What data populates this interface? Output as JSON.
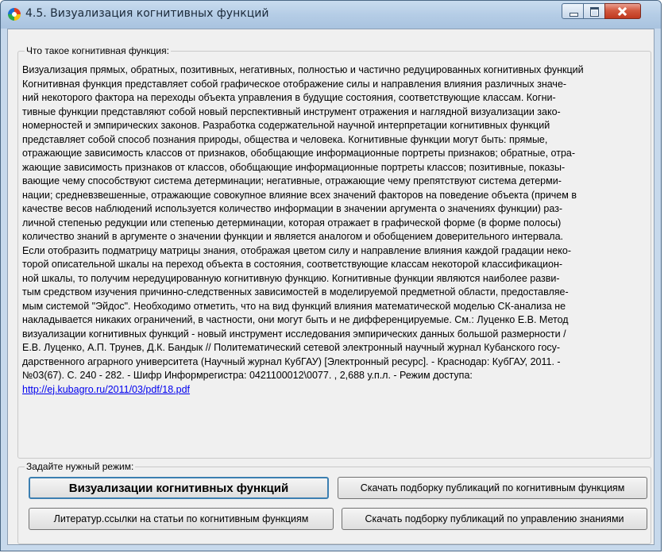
{
  "window": {
    "title": "4.5. Визуализация когнитивных функций"
  },
  "group_description": {
    "title": "Что такое когнитивная функция:",
    "lines": [
      "Визуализация прямых, обратных, позитивных, негативных, полностью и частично редуцированных когнитивных функций",
      "Когнитивная функция представляет собой графическое отображение силы и направления влияния различных значе-",
      "ний некоторого фактора на переходы объекта управления в будущие состояния, соответствующие классам. Когни-",
      "тивные функции представляют собой новый перспективный инструмент отражения и наглядной визуализации зако-",
      "номерностей и эмпирических законов. Разработка содержательной научной интерпретации когнитивных функций",
      "представляет собой способ познания природы, общества и человека. Когнитивные функции могут быть: прямые,",
      "отражающие зависимость классов от признаков, обобщающие информационные портреты признаков; обратные, отра-",
      "жающие зависимость признаков от классов, обобщающие информационные портреты классов; позитивные, показы-",
      "вающие чему способствуют система детерминации; негативные, отражающие чему препятствуют система детерми-",
      "нации; средневзвешенные, отражающие совокупное влияние всех значений факторов на поведение объекта (причем в",
      "качестве весов наблюдений используется количество информации в значении аргумента о значениях функции) раз-",
      "личной степенью редукции или степенью детерминации, которая отражает в графической форме (в форме полосы)",
      "количество знаний в аргументе о значении функции и является аналогом и обобщением доверительного интервала.",
      "Если отобразить подматрицу матрицы знания, отображая цветом силу и направление влияния каждой градации неко-",
      "торой описательной шкалы на переход объекта в состояния, соответствующие классам некоторой классификацион-",
      "ной шкалы, то получим нередуцированную когнитивную функцию. Когнитивные функции являются наиболее разви-",
      "тым средством изучения причинно-следственных зависимостей в моделируемой предметной области, предоставляе-",
      "мым системой \"Эйдос\". Необходимо отметить, что на вид функций влияния математической моделью СК-анализа не",
      "накладывается никаких ограничений, в частности, они могут быть и не дифференцируемые. См.: Луценко Е.В. Метод",
      "визуализации когнитивных функций - новый инструмент исследования эмпирических данных большой размерности /",
      "Е.В. Луценко, А.П. Трунев, Д.К. Бандык // Политематический сетевой электронный научный журнал Кубанского госу-",
      "дарственного аграрного университета (Научный журнал КубГАУ) [Электронный ресурс]. - Краснодар: КубГАУ, 2011. -",
      "№03(67). С. 240 - 282. - Шифр Информрегистра: 0421100012\\0077. , 2,688 у.п.л. - Режим доступа:"
    ],
    "link": "http://ej.kubagro.ru/2011/03/pdf/18.pdf"
  },
  "group_mode": {
    "title": "Задайте нужный режим:",
    "buttons": {
      "visualize": "Визуализации когнитивных функций",
      "download_cognitive": "Скачать подборку публикаций по когнитивным функциям",
      "literature": "Литератур.ссылки на статьи по когнитивным функциям",
      "download_knowledge": "Скачать подборку публикаций по управлению  знаниями"
    }
  },
  "colors": {
    "link": "#0000ee",
    "default_button_border": "#3c7fb1",
    "close_button": "#c0381f"
  }
}
